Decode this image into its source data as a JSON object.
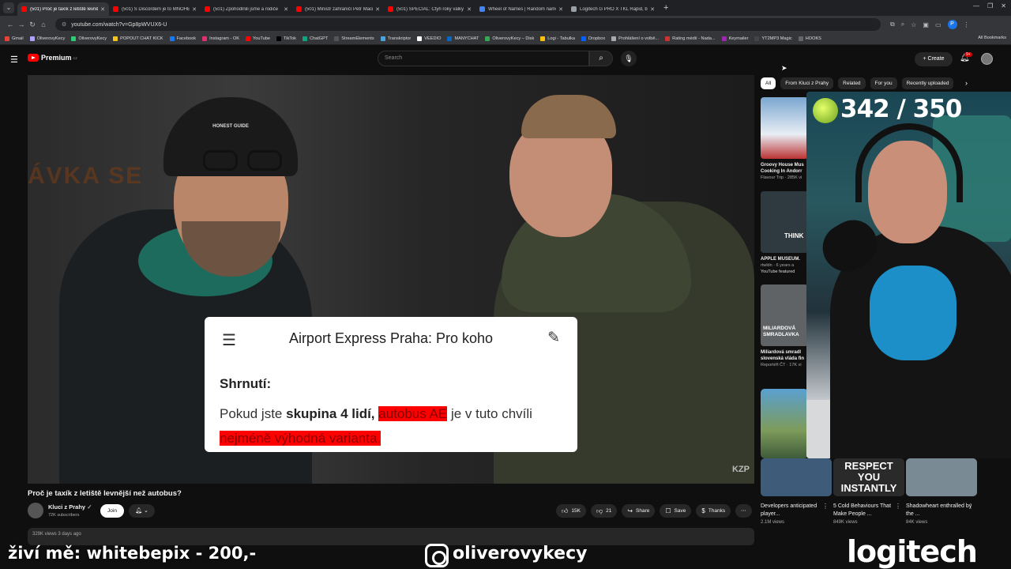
{
  "browser": {
    "tabs": [
      {
        "title": "(501) Proč je taxík z letiště levnější",
        "favicon": "youtube-icon",
        "active": true
      },
      {
        "title": "(501) S Discordem je to MNOHEM",
        "favicon": "youtube-icon",
        "active": false
      },
      {
        "title": "(501) Zpohodlnili jsme a rodiče",
        "favicon": "youtube-icon",
        "active": false
      },
      {
        "title": "(501) Ministr zahraničí Petr Macinka",
        "favicon": "youtube-icon",
        "active": false
      },
      {
        "title": "(501) SPECIÁL: Čtyři roky války",
        "favicon": "youtube-icon",
        "active": false
      },
      {
        "title": "Wheel of Names | Random name",
        "favicon": "wheel-icon",
        "active": false
      },
      {
        "title": "Logitech G PRO X TKL Rapid, black",
        "favicon": "page-icon",
        "active": false
      }
    ],
    "url": "youtube.com/watch?v=Gp8pWVUX6-U",
    "bookmarks": [
      "Gmail",
      "OliverovyKecy",
      "OliverovyKecy",
      "POPOUT CHAT KICK",
      "Facebook",
      "Instagram - OK",
      "YouTube",
      "TikTok",
      "ChatGPT",
      "StreamElements",
      "Transkriptor",
      "VEEDIO",
      "MANYCHAT",
      "OliverovyKecy – Disk",
      "Logi - Tabulka",
      "Dropbox",
      "Prohlášení o volbě...",
      "Rating médií - Nada...",
      "Keymailer",
      "YT2MP3 Magic",
      "HOOKS"
    ],
    "all_bookmarks": "All Bookmarks"
  },
  "yt": {
    "logo": "Premium",
    "region": "CZ",
    "search_placeholder": "Search",
    "create": "Create",
    "notif_badge": "9+"
  },
  "video": {
    "hat_text": "HONEST GUIDE",
    "sign_text": "ÁVKA SE",
    "popup_title": "Airport Express Praha: Pro koho",
    "popup_heading": "Shrnutí:",
    "popup_text_1": "Pokud jste ",
    "popup_bold": "skupina 4 lidí, ",
    "popup_hl1": "autobus AE",
    "popup_text_2": " je v tuto chvíli ",
    "popup_hl2": "nejméně výhodná varianta.",
    "watermark": "KZP",
    "title": "Proč je taxík z letiště levnější než autobus?",
    "channel": "Kluci z Prahy",
    "subs": "72K subscribers",
    "join": "Join",
    "likes": "15K",
    "dislikes": "21",
    "share": "Share",
    "save": "Save",
    "thanks": "Thanks",
    "desc": "329K views  3 days ago"
  },
  "sidebar": {
    "chips": [
      "All",
      "From Kluci z Prahy",
      "Related",
      "For you",
      "Recently uploaded"
    ],
    "recs": [
      {
        "title": "Groovy House Mus",
        "title2": "Cooking In Andorr",
        "meta": "Flavour Trip · 285K vi",
        "color": "#5a7fa0"
      },
      {
        "title": "APPLE MUSEUM.",
        "title2": "",
        "meta": "rtwldn · 6 years a",
        "meta2": "YouTube featured",
        "overlay": "THINK",
        "color": "#38424a"
      },
      {
        "title": "Miliardová smradl",
        "title2": "slovenská vláda fin",
        "meta": "Reportéři ČT · 17K vi",
        "overlay": "MILIARDOVÁ SMRADLAVKA",
        "color": "#6b6b6b"
      }
    ],
    "shorts": [
      {
        "title": "Developers anticipated player...",
        "meta": "2.1M views",
        "overlay": "",
        "color": "#3e5b7a"
      },
      {
        "title": "5 Cold Behaviours That Make People ...",
        "meta": "849K views",
        "overlay": "RESPECT YOU INSTANTLY",
        "color": "#2a2a2a"
      },
      {
        "title": "Shadowheart enthralled by the ...",
        "meta": "84K views",
        "overlay": "",
        "color": "#7a8a95"
      }
    ]
  },
  "stream": {
    "counter": "342 / 350",
    "bottom_left": "živí mě: whitebepix - 200,-",
    "instagram": "oliverovykecy",
    "sponsor": "logitech"
  }
}
